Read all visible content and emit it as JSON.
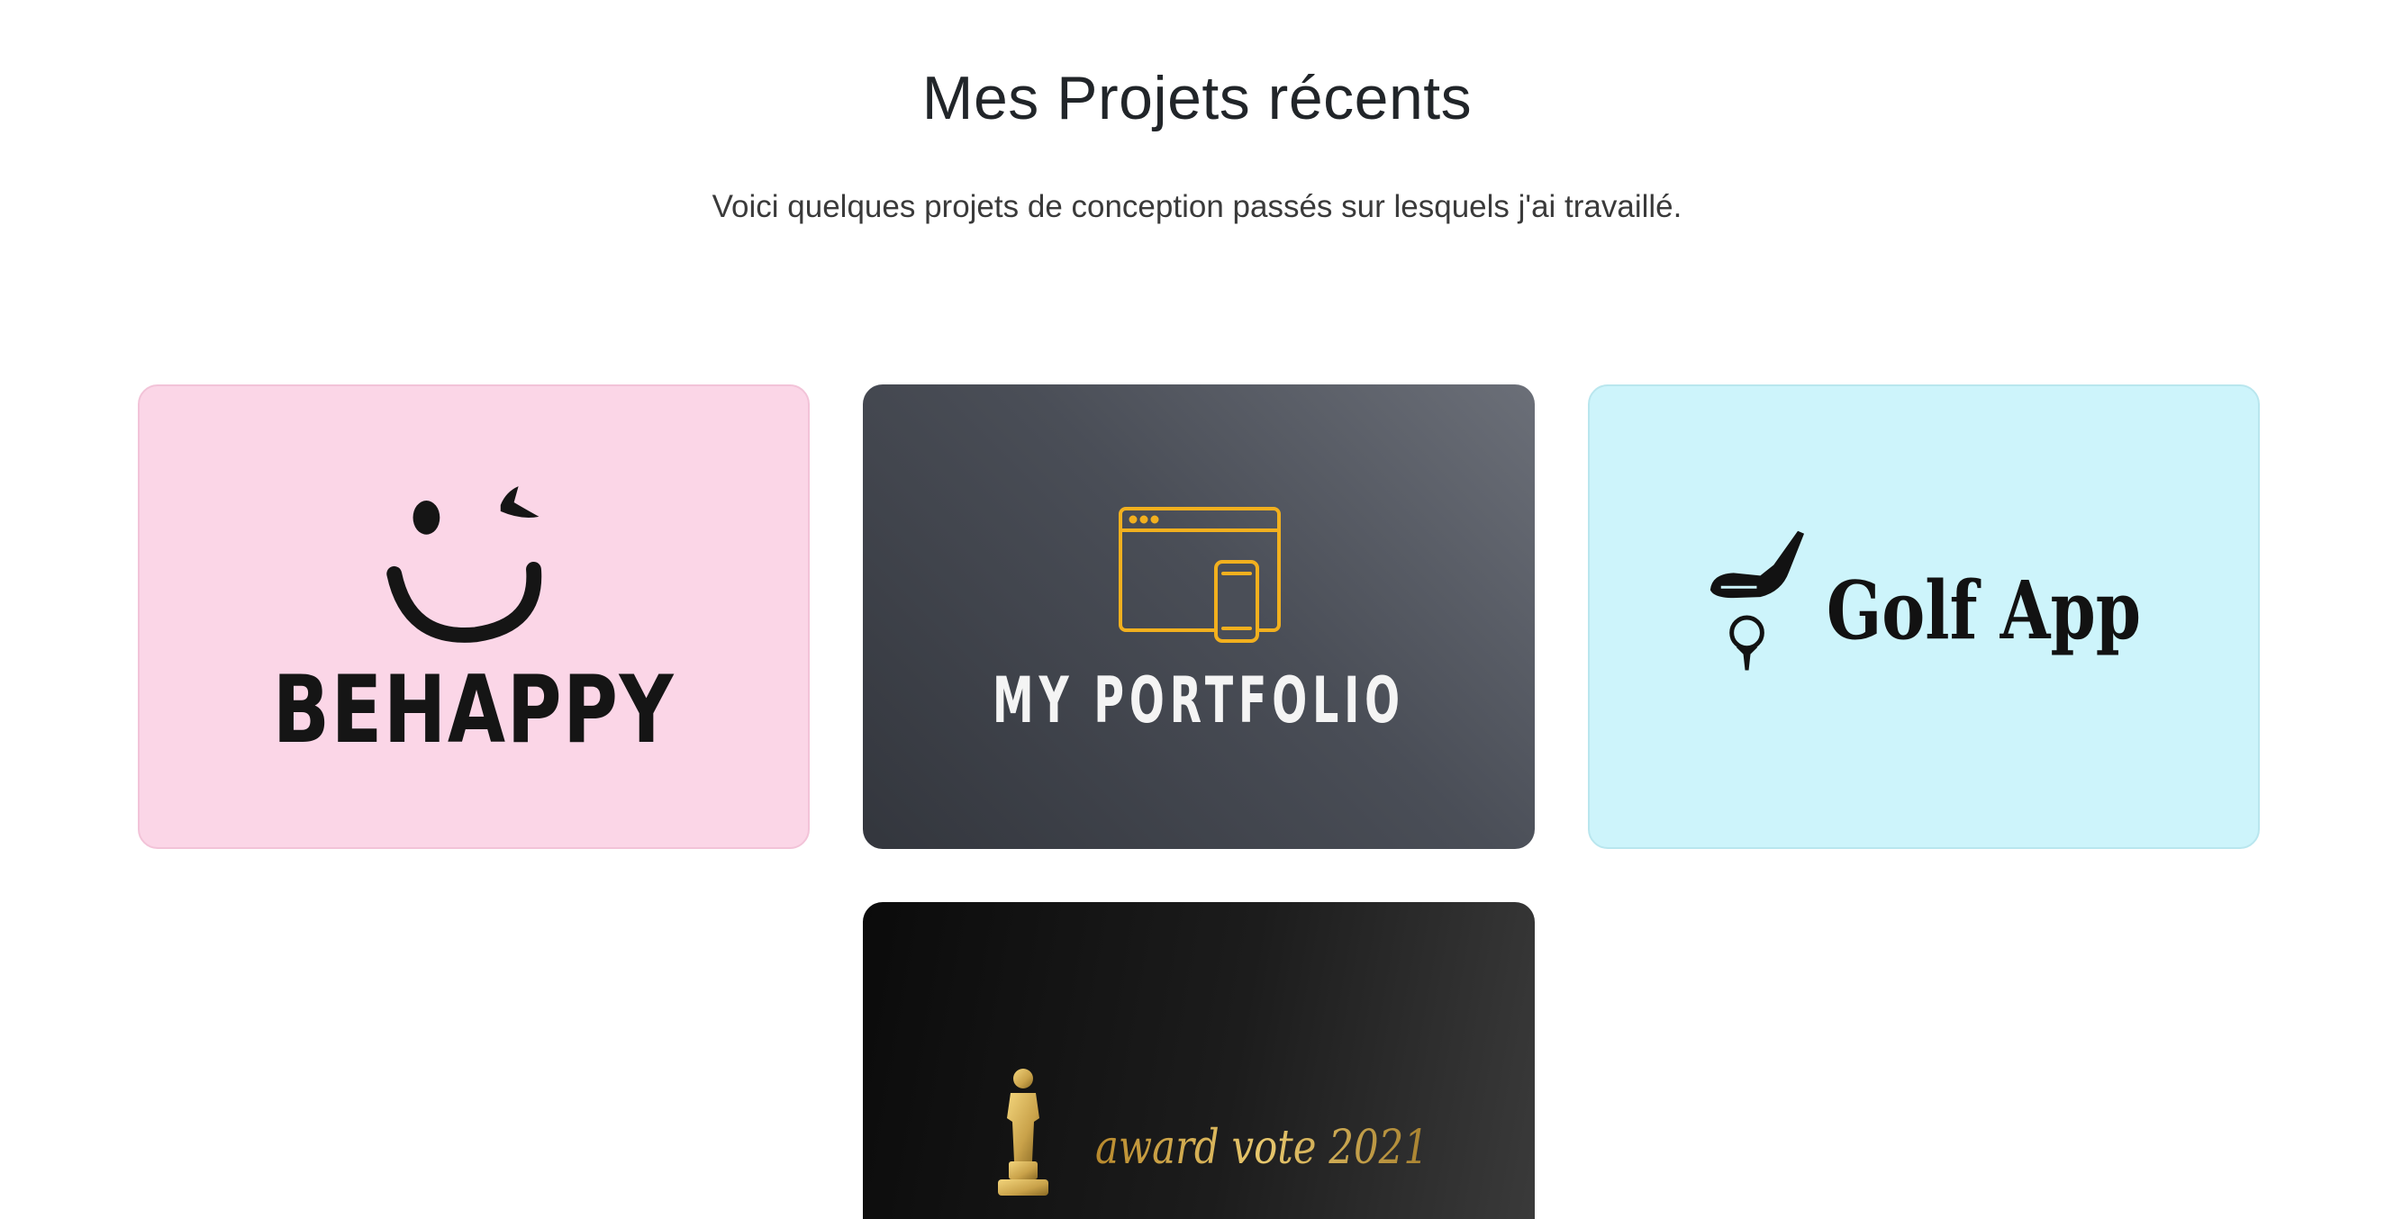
{
  "section": {
    "title": "Mes Projets récents",
    "subtitle": "Voici quelques projets de conception passés sur lesquels j'ai travaillé."
  },
  "projects": [
    {
      "logo_text": "BEHAPPY",
      "background": "#fbd6e7",
      "icon": "winking-smiley-icon"
    },
    {
      "logo_text": "MY PORTFOLIO",
      "background": "#4a4e57",
      "accent": "#f2b01e",
      "icon": "browser-mobile-icon"
    },
    {
      "logo_text": "Golf App",
      "background": "#cdf4fb",
      "icon": "golf-club-ball-icon"
    },
    {
      "logo_text": "award vote 2021",
      "background": "#111111",
      "accent": "#c9a24a",
      "icon": "trophy-statuette-icon"
    }
  ]
}
